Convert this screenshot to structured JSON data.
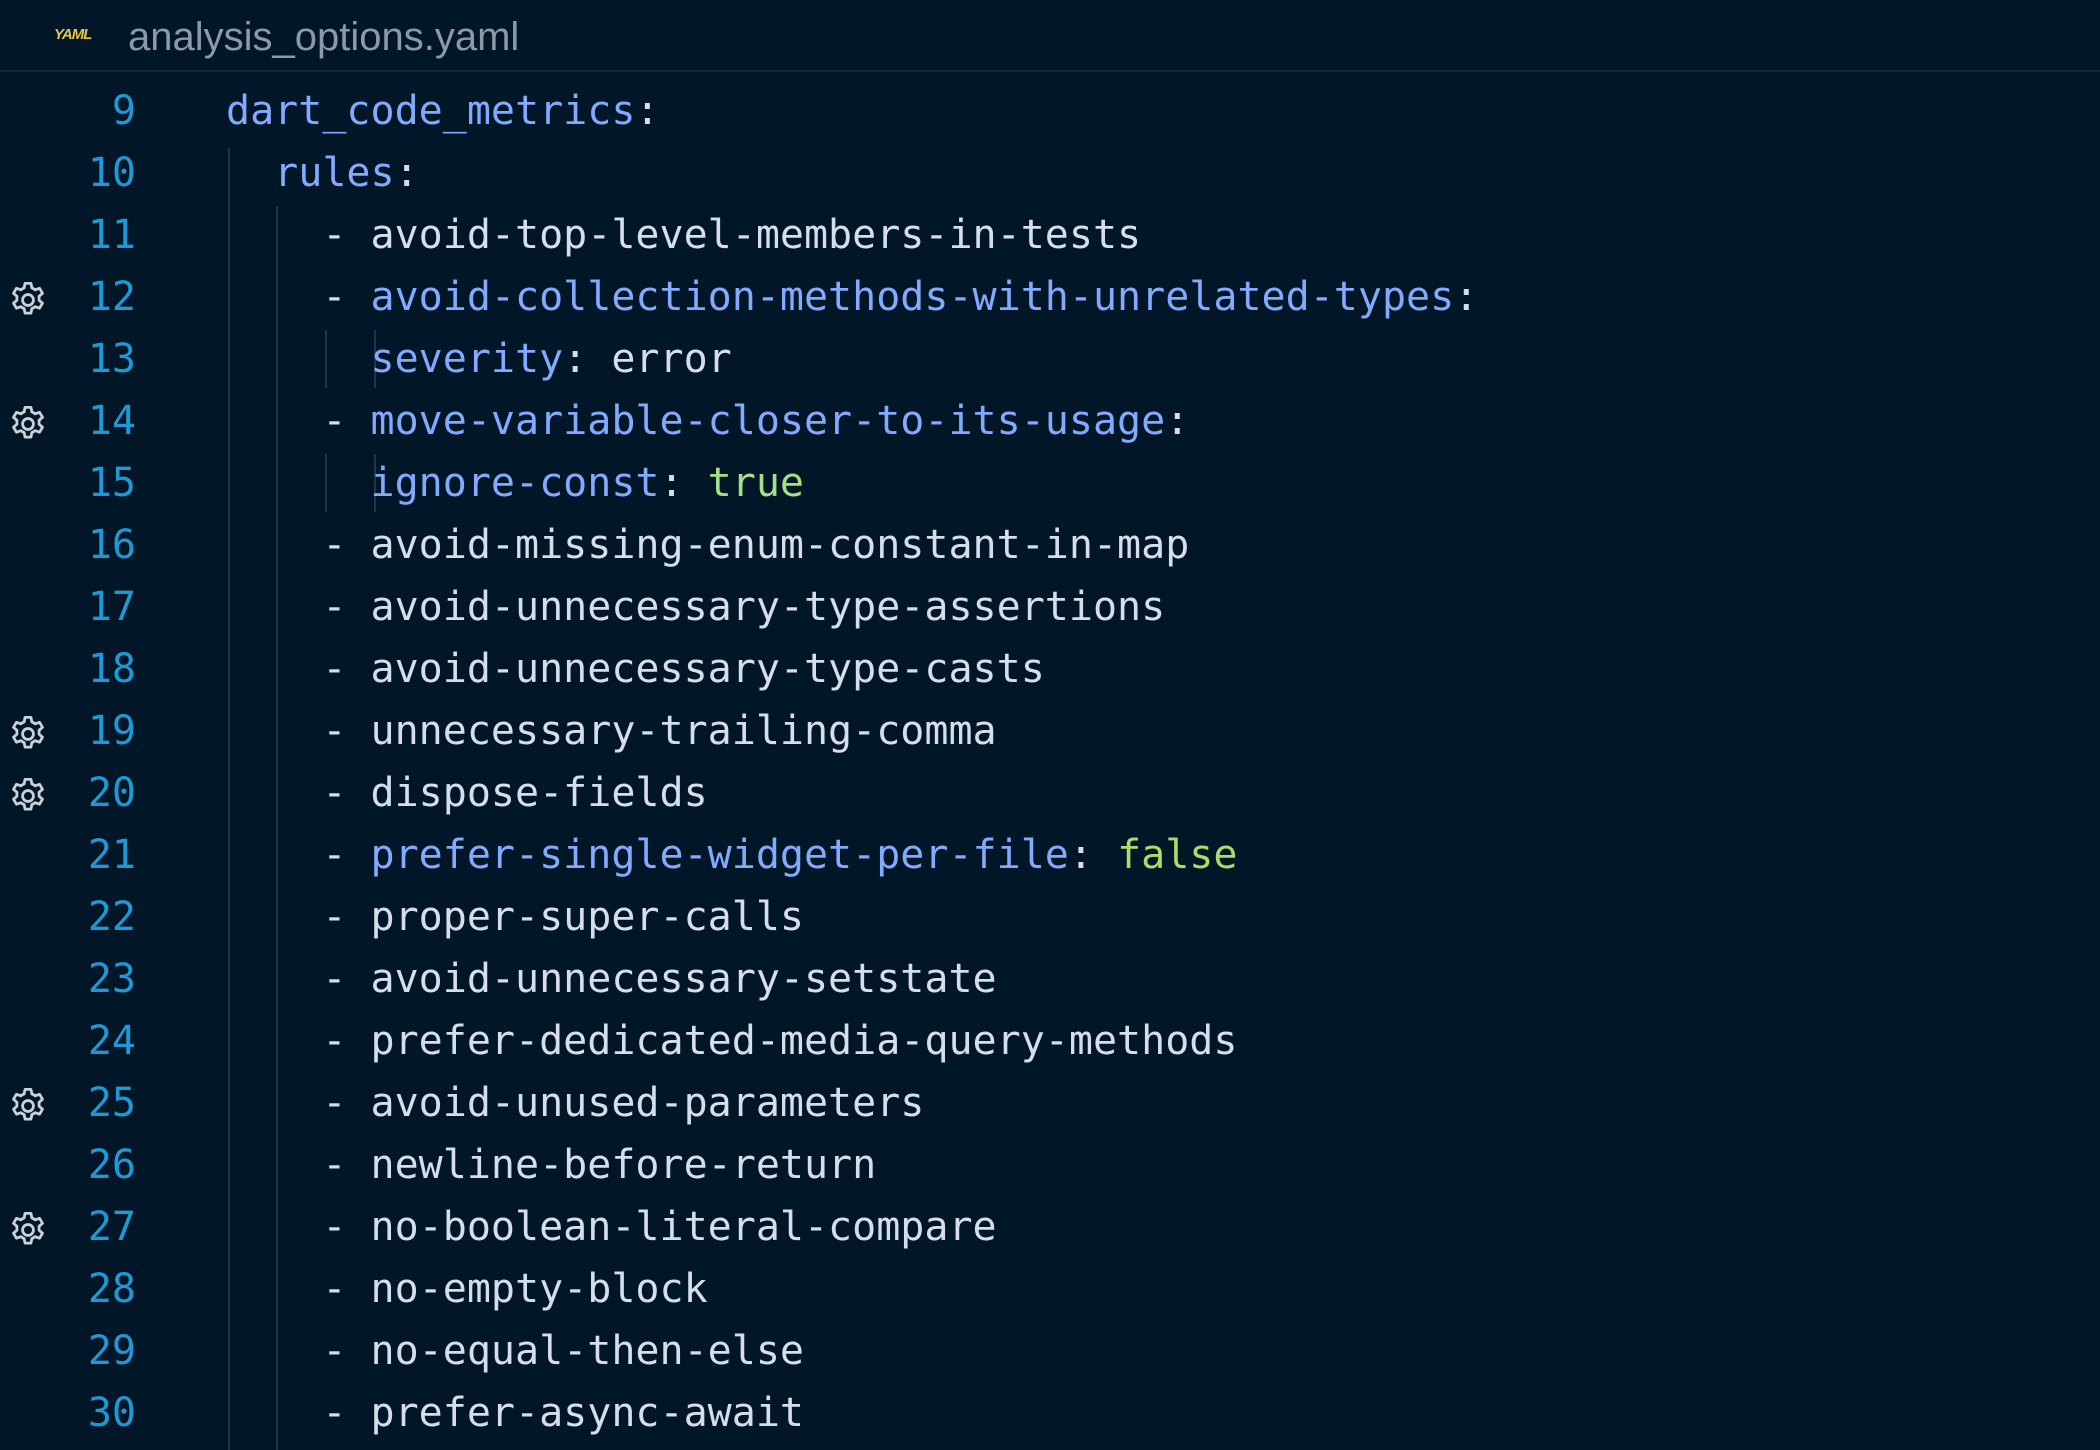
{
  "tab": {
    "icon": "yaml-icon",
    "icon_text": "YAML",
    "file_name": "analysis_options.yaml",
    "accent_color": "#e8c547"
  },
  "colors": {
    "background": "#011627",
    "line_number": "#1d9ad6",
    "key": "#82aaff",
    "plain": "#d6deeb",
    "boolean": "#addb67"
  },
  "lines": [
    {
      "number": "9",
      "gear": false,
      "indent": "",
      "dash": "",
      "text": "dart_code_metrics",
      "kind": "key",
      "suffix": ":",
      "value": "",
      "value_kind": ""
    },
    {
      "number": "10",
      "gear": false,
      "indent": "  ",
      "dash": "",
      "text": "rules",
      "kind": "key",
      "suffix": ":",
      "value": "",
      "value_kind": ""
    },
    {
      "number": "11",
      "gear": false,
      "indent": "    ",
      "dash": "- ",
      "text": "avoid-top-level-members-in-tests",
      "kind": "plain",
      "suffix": "",
      "value": "",
      "value_kind": ""
    },
    {
      "number": "12",
      "gear": true,
      "indent": "    ",
      "dash": "- ",
      "text": "avoid-collection-methods-with-unrelated-types",
      "kind": "key",
      "suffix": ":",
      "value": "",
      "value_kind": ""
    },
    {
      "number": "13",
      "gear": false,
      "indent": "      ",
      "dash": "",
      "text": "severity",
      "kind": "key",
      "suffix": ": ",
      "value": "error",
      "value_kind": "plain"
    },
    {
      "number": "14",
      "gear": true,
      "indent": "    ",
      "dash": "- ",
      "text": "move-variable-closer-to-its-usage",
      "kind": "key",
      "suffix": ":",
      "value": "",
      "value_kind": ""
    },
    {
      "number": "15",
      "gear": false,
      "indent": "      ",
      "dash": "",
      "text": "ignore-const",
      "kind": "key",
      "suffix": ": ",
      "value": "true",
      "value_kind": "bool"
    },
    {
      "number": "16",
      "gear": false,
      "indent": "    ",
      "dash": "- ",
      "text": "avoid-missing-enum-constant-in-map",
      "kind": "plain",
      "suffix": "",
      "value": "",
      "value_kind": ""
    },
    {
      "number": "17",
      "gear": false,
      "indent": "    ",
      "dash": "- ",
      "text": "avoid-unnecessary-type-assertions",
      "kind": "plain",
      "suffix": "",
      "value": "",
      "value_kind": ""
    },
    {
      "number": "18",
      "gear": false,
      "indent": "    ",
      "dash": "- ",
      "text": "avoid-unnecessary-type-casts",
      "kind": "plain",
      "suffix": "",
      "value": "",
      "value_kind": ""
    },
    {
      "number": "19",
      "gear": true,
      "indent": "    ",
      "dash": "- ",
      "text": "unnecessary-trailing-comma",
      "kind": "plain",
      "suffix": "",
      "value": "",
      "value_kind": ""
    },
    {
      "number": "20",
      "gear": true,
      "indent": "    ",
      "dash": "- ",
      "text": "dispose-fields",
      "kind": "plain",
      "suffix": "",
      "value": "",
      "value_kind": ""
    },
    {
      "number": "21",
      "gear": false,
      "indent": "    ",
      "dash": "- ",
      "text": "prefer-single-widget-per-file",
      "kind": "key",
      "suffix": ": ",
      "value": "false",
      "value_kind": "bool"
    },
    {
      "number": "22",
      "gear": false,
      "indent": "    ",
      "dash": "- ",
      "text": "proper-super-calls",
      "kind": "plain",
      "suffix": "",
      "value": "",
      "value_kind": ""
    },
    {
      "number": "23",
      "gear": false,
      "indent": "    ",
      "dash": "- ",
      "text": "avoid-unnecessary-setstate",
      "kind": "plain",
      "suffix": "",
      "value": "",
      "value_kind": ""
    },
    {
      "number": "24",
      "gear": false,
      "indent": "    ",
      "dash": "- ",
      "text": "prefer-dedicated-media-query-methods",
      "kind": "plain",
      "suffix": "",
      "value": "",
      "value_kind": ""
    },
    {
      "number": "25",
      "gear": true,
      "indent": "    ",
      "dash": "- ",
      "text": "avoid-unused-parameters",
      "kind": "plain",
      "suffix": "",
      "value": "",
      "value_kind": ""
    },
    {
      "number": "26",
      "gear": false,
      "indent": "    ",
      "dash": "- ",
      "text": "newline-before-return",
      "kind": "plain",
      "suffix": "",
      "value": "",
      "value_kind": ""
    },
    {
      "number": "27",
      "gear": true,
      "indent": "    ",
      "dash": "- ",
      "text": "no-boolean-literal-compare",
      "kind": "plain",
      "suffix": "",
      "value": "",
      "value_kind": ""
    },
    {
      "number": "28",
      "gear": false,
      "indent": "    ",
      "dash": "- ",
      "text": "no-empty-block",
      "kind": "plain",
      "suffix": "",
      "value": "",
      "value_kind": ""
    },
    {
      "number": "29",
      "gear": false,
      "indent": "    ",
      "dash": "- ",
      "text": "no-equal-then-else",
      "kind": "plain",
      "suffix": "",
      "value": "",
      "value_kind": ""
    },
    {
      "number": "30",
      "gear": false,
      "indent": "    ",
      "dash": "- ",
      "text": "prefer-async-await",
      "kind": "plain",
      "suffix": "",
      "value": "",
      "value_kind": ""
    }
  ]
}
